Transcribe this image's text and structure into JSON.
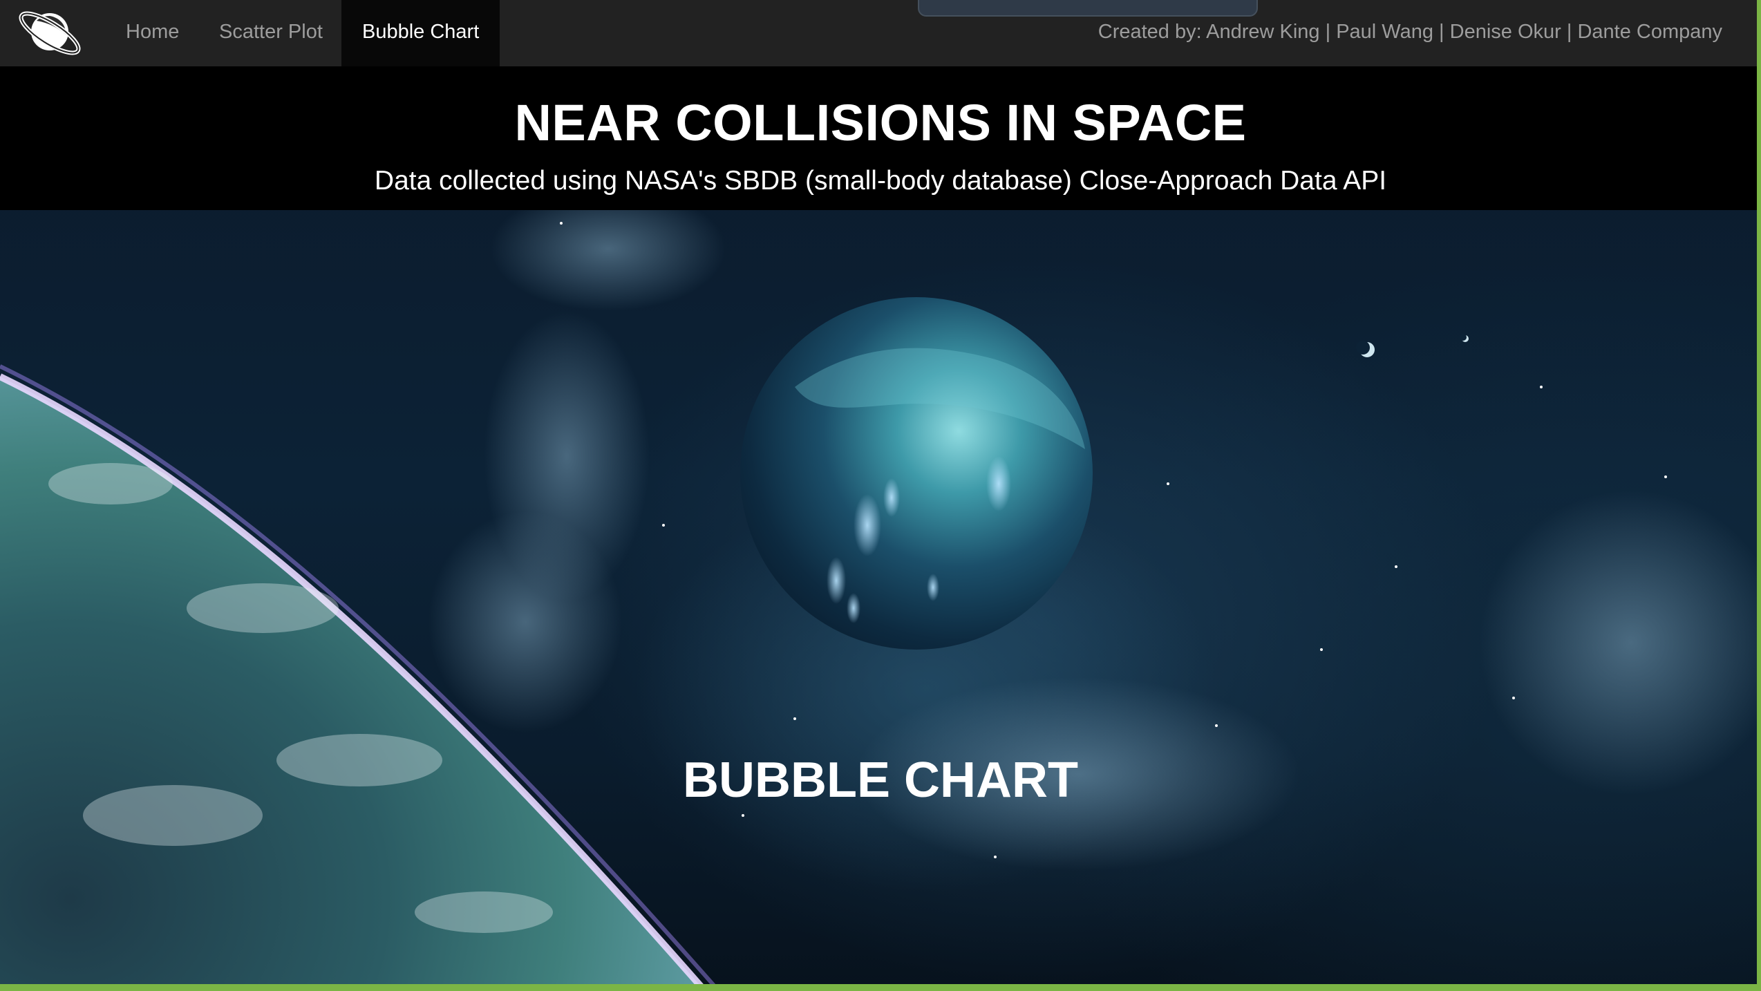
{
  "nav": {
    "brand_icon": "planet-ringed-icon",
    "items": [
      {
        "label": "Home",
        "active": false
      },
      {
        "label": "Scatter Plot",
        "active": false
      },
      {
        "label": "Bubble Chart",
        "active": true
      }
    ],
    "credits": "Created by: Andrew King | Paul Wang | Denise Okur | Dante Company"
  },
  "header": {
    "title": "NEAR COLLISIONS IN SPACE",
    "subtitle": "Data collected using NASA's SBDB (small-body database) Close-Approach Data API"
  },
  "section": {
    "heading": "BUBBLE CHART"
  },
  "colors": {
    "navbar_bg": "#222222",
    "nav_active_bg": "#080808",
    "nav_text": "#9d9d9d",
    "title_text": "#ffffff",
    "accent_border": "#7bb545"
  }
}
